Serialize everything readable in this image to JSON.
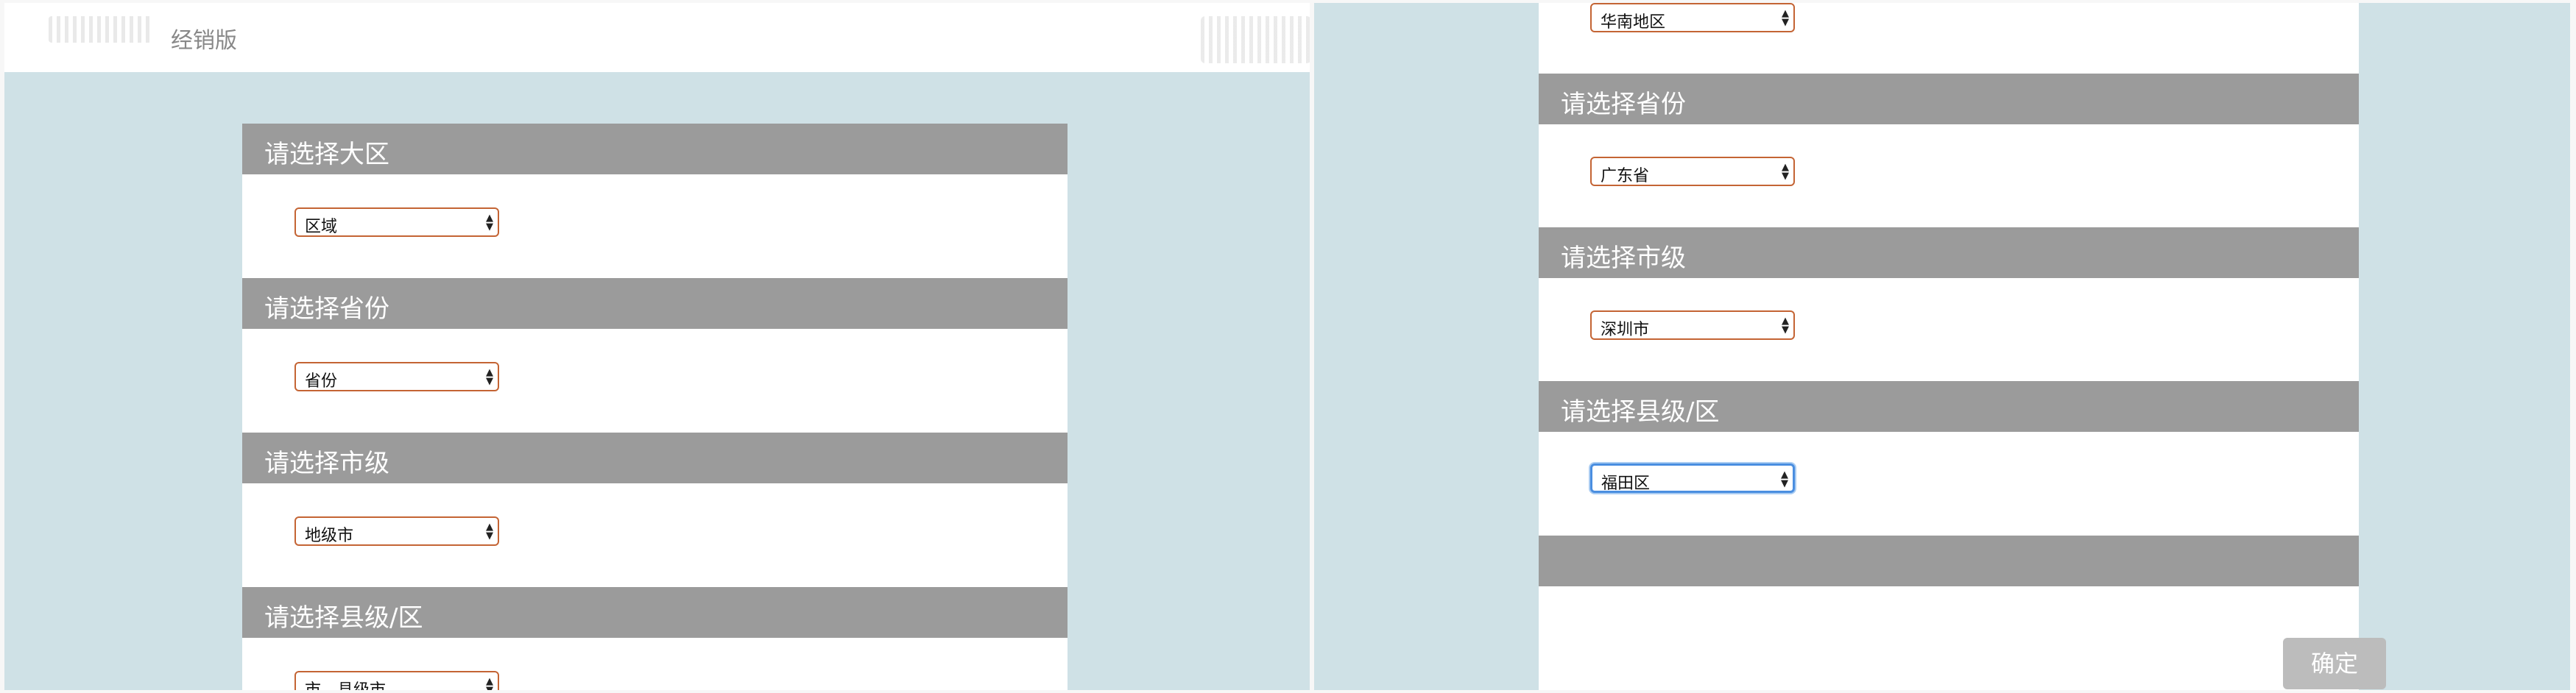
{
  "header": {
    "version": "经销版"
  },
  "left": {
    "sections": [
      {
        "title": "请选择大区",
        "value": "区域"
      },
      {
        "title": "请选择省份",
        "value": "省份"
      },
      {
        "title": "请选择市级",
        "value": "地级市"
      },
      {
        "title": "请选择县级/区",
        "value": "市、县级市"
      }
    ]
  },
  "right": {
    "top_value": "华南地区",
    "sections": [
      {
        "title": "请选择省份",
        "value": "广东省"
      },
      {
        "title": "请选择市级",
        "value": "深圳市"
      },
      {
        "title": "请选择县级/区",
        "value": "福田区"
      }
    ],
    "confirm_label": "确定"
  },
  "colors": {
    "header_gray": "#9b9b9b",
    "bg": "#cfe1e6",
    "select_border": "#c46434",
    "focus": "#4a8ee0"
  },
  "icons": [
    "logo",
    "select-arrows-icon"
  ]
}
